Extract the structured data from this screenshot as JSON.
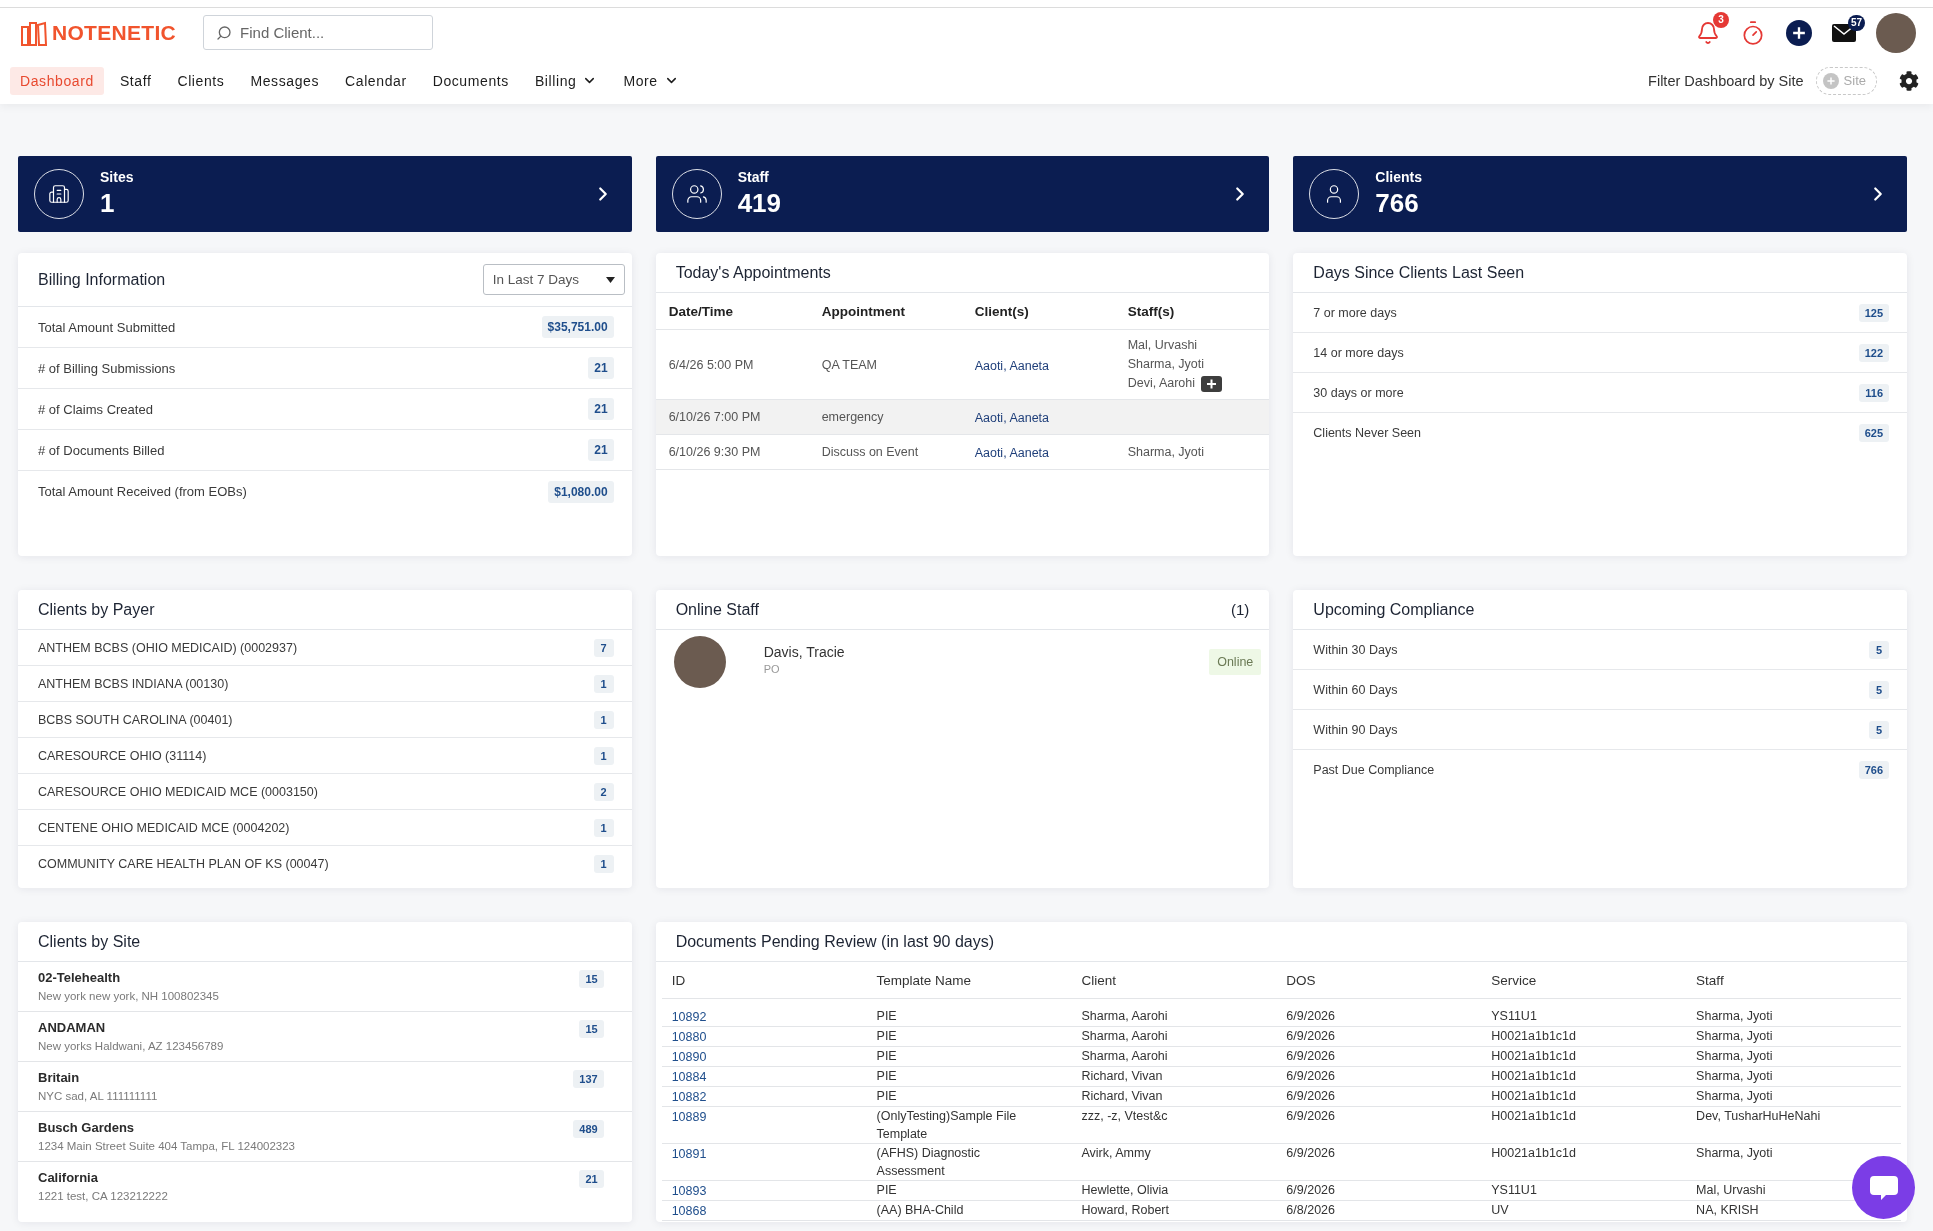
{
  "header": {
    "logo": "NOTENETIC",
    "search": {
      "placeholder": "Find Client..."
    },
    "notification_count": "3",
    "message_count": "57"
  },
  "nav": {
    "items": [
      {
        "label": "Dashboard",
        "selected": true,
        "dropdown": false
      },
      {
        "label": "Staff",
        "selected": false,
        "dropdown": false
      },
      {
        "label": "Clients",
        "selected": false,
        "dropdown": false
      },
      {
        "label": "Messages",
        "selected": false,
        "dropdown": false
      },
      {
        "label": "Calendar",
        "selected": false,
        "dropdown": false
      },
      {
        "label": "Documents",
        "selected": false,
        "dropdown": false
      },
      {
        "label": "Billing",
        "selected": false,
        "dropdown": true
      },
      {
        "label": "More",
        "selected": false,
        "dropdown": true
      }
    ],
    "filter_label": "Filter Dashboard by Site",
    "site_button": "Site"
  },
  "stats": [
    {
      "kind": "building",
      "label": "Sites",
      "value": "1"
    },
    {
      "kind": "group",
      "label": "Staff",
      "value": "419"
    },
    {
      "kind": "person",
      "label": "Clients",
      "value": "766"
    }
  ],
  "billing": {
    "title": "Billing Information",
    "range": "In Last 7 Days",
    "rows": [
      {
        "label": "Total Amount Submitted",
        "value": "$35,751.00"
      },
      {
        "label": "# of Billing Submissions",
        "value": "21"
      },
      {
        "label": "# of Claims Created",
        "value": "21"
      },
      {
        "label": "# of Documents Billed",
        "value": "21"
      },
      {
        "label": "Total Amount Received (from EOBs)",
        "value": "$1,080.00"
      }
    ]
  },
  "appointments": {
    "title": "Today's Appointments",
    "columns": [
      "Date/Time",
      "Appointment",
      "Client(s)",
      "Staff(s)"
    ],
    "rows": [
      {
        "datetime": "6/4/26 5:00 PM",
        "appointment": "QA TEAM",
        "client": "Aaoti, Aaneta",
        "staff": [
          "Mal, Urvashi",
          "Sharma, Jyoti",
          "Devi, Aarohi"
        ],
        "more_staff": true
      },
      {
        "datetime": "6/10/26 7:00 PM",
        "appointment": "emergency",
        "client": "Aaoti, Aaneta",
        "more_staff": false
      },
      {
        "datetime": "6/10/26 9:30 PM",
        "appointment": "Discuss on Event",
        "client": "Aaoti, Aaneta",
        "staff": [
          "Sharma, Jyoti"
        ],
        "more_staff": false
      }
    ]
  },
  "last_seen": {
    "title": "Days Since Clients Last Seen",
    "rows": [
      {
        "label": "7 or more days",
        "value": "125"
      },
      {
        "label": "14 or more days",
        "value": "122"
      },
      {
        "label": "30 days or more",
        "value": "116"
      },
      {
        "label": "Clients Never Seen",
        "value": "625"
      }
    ]
  },
  "clients_by_payer": {
    "title": "Clients by Payer",
    "rows": [
      {
        "label": "ANTHEM BCBS (OHIO MEDICAID) (0002937)",
        "value": "7"
      },
      {
        "label": "ANTHEM BCBS INDIANA (00130)",
        "value": "1"
      },
      {
        "label": "BCBS SOUTH CAROLINA (00401)",
        "value": "1"
      },
      {
        "label": "CARESOURCE OHIO (31114)",
        "value": "1"
      },
      {
        "label": "CARESOURCE OHIO MEDICAID MCE (0003150)",
        "value": "2"
      },
      {
        "label": "CENTENE OHIO MEDICAID MCE (0004202)",
        "value": "1"
      },
      {
        "label": "COMMUNITY CARE HEALTH PLAN OF KS (00047)",
        "value": "1"
      }
    ]
  },
  "online_staff": {
    "title": "Online Staff",
    "count": "(1)",
    "people": [
      {
        "name": "Davis, Tracie",
        "role": "PO",
        "status": "Online"
      }
    ]
  },
  "compliance": {
    "title": "Upcoming Compliance",
    "rows": [
      {
        "label": "Within 30 Days",
        "value": "5"
      },
      {
        "label": "Within 60 Days",
        "value": "5"
      },
      {
        "label": "Within 90 Days",
        "value": "5"
      },
      {
        "label": "Past Due Compliance",
        "value": "766"
      }
    ]
  },
  "clients_by_site": {
    "title": "Clients by Site",
    "rows": [
      {
        "name": "02-Telehealth",
        "address": "New york new york, NH 100802345",
        "count": "15"
      },
      {
        "name": "ANDAMAN",
        "address": "New yorks Haldwani, AZ 123456789",
        "count": "15"
      },
      {
        "name": "Britain",
        "address": "NYC sad, AL 111111111",
        "count": "137"
      },
      {
        "name": "Busch Gardens",
        "address": "1234 Main Street Suite 404 Tampa, FL 124002323",
        "count": "489"
      },
      {
        "name": "California",
        "address": "1221 test, CA 123212222",
        "count": "21"
      }
    ]
  },
  "documents": {
    "title": "Documents Pending Review (in last 90 days)",
    "columns": [
      "ID",
      "Template Name",
      "Client",
      "DOS",
      "Service",
      "Staff"
    ],
    "rows": [
      [
        "10892",
        "PIE",
        "Sharma, Aarohi",
        "6/9/2026",
        "YS11U1",
        "Sharma, Jyoti"
      ],
      [
        "10880",
        "PIE",
        "Sharma, Aarohi",
        "6/9/2026",
        "H0021a1b1c1d",
        "Sharma, Jyoti"
      ],
      [
        "10890",
        "PIE",
        "Sharma, Aarohi",
        "6/9/2026",
        "H0021a1b1c1d",
        "Sharma, Jyoti"
      ],
      [
        "10884",
        "PIE",
        "Richard, Vivan",
        "6/9/2026",
        "H0021a1b1c1d",
        "Sharma, Jyoti"
      ],
      [
        "10882",
        "PIE",
        "Richard, Vivan",
        "6/9/2026",
        "H0021a1b1c1d",
        "Sharma, Jyoti"
      ],
      [
        "10889",
        "(OnlyTesting)Sample File Template",
        "zzz, -z, Vtest&c",
        "6/9/2026",
        "H0021a1b1c1d",
        "Dev, TusharHuHeNahi"
      ],
      [
        "10891",
        "(AFHS) Diagnostic Assessment",
        "Avirk, Ammy",
        "6/9/2026",
        "H0021a1b1c1d",
        "Sharma, Jyoti"
      ],
      [
        "10893",
        "PIE",
        "Hewlette, Olivia",
        "6/9/2026",
        "YS11U1",
        "Mal, Urvashi"
      ],
      [
        "10868",
        "(AA) BHA-Child",
        "Howard, Robert",
        "6/8/2026",
        "UV",
        "NA, KRISH"
      ]
    ]
  }
}
